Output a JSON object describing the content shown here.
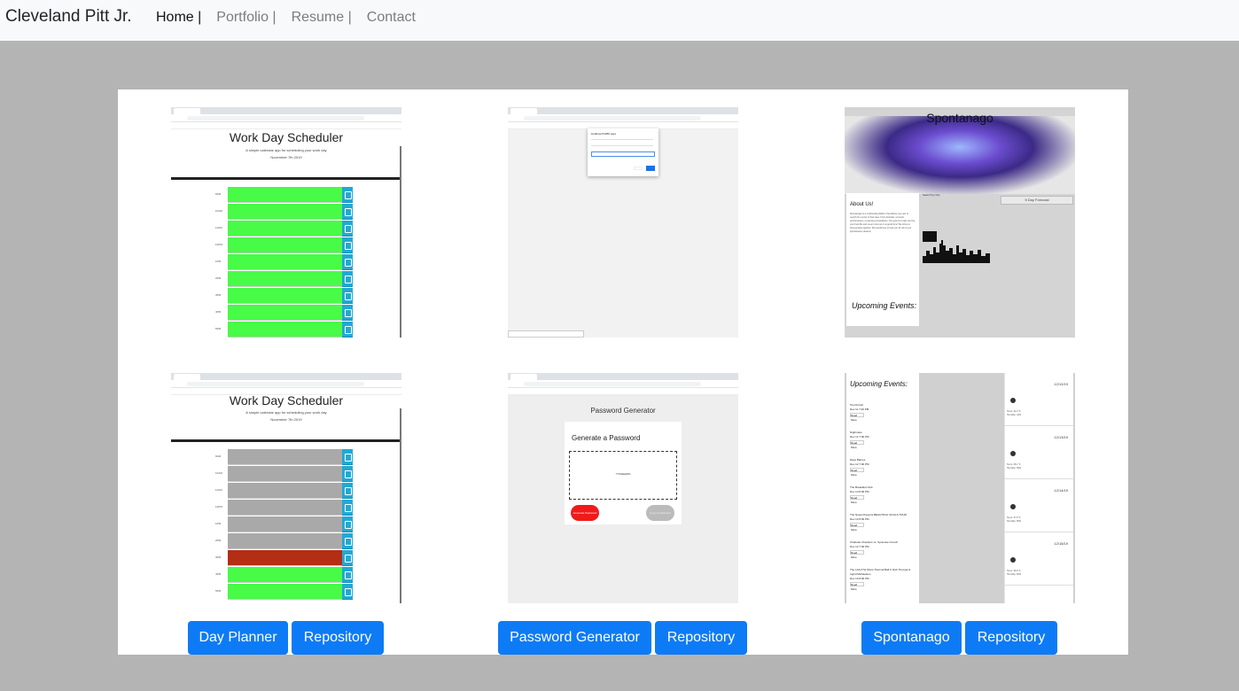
{
  "navbar": {
    "brand": "Cleveland Pitt Jr.",
    "links": [
      {
        "label": "Home |",
        "active": true
      },
      {
        "label": "Portfolio |",
        "active": false
      },
      {
        "label": "Resume |",
        "active": false
      },
      {
        "label": "Contact",
        "active": false
      }
    ]
  },
  "projects": [
    {
      "app_label": "Day Planner",
      "repo_label": "Repository",
      "thumbnail": {
        "title": "Work Day Scheduler",
        "subtitle": "A simple calendar app for scheduling your work day",
        "date": "November 7th 2019"
      }
    },
    {
      "app_label": "Password Generator",
      "repo_label": "Repository",
      "thumbnail": {
        "dialog_title": "localhost:51050 says"
      }
    },
    {
      "app_label": "Spontanago",
      "repo_label": "Repository",
      "thumbnail": {
        "title": "Spontanago",
        "about_title": "About Us!",
        "about_text": "Spontanago is a multimedia platform that allows you user to search for events in their area. From festivals, concerts, performances, to gaming competitions. Our goal is to help you live your best life and never miss out on a good time! We strive to bring people together. We would love to help you for all of your spontaneous desires!",
        "upcoming": "Upcoming Events:",
        "search_label": "Search by City",
        "search_button": "SEARCH",
        "forecast": "5 Day Forecast"
      }
    },
    {
      "app_label": "",
      "repo_label": "",
      "thumbnail": {
        "title": "Work Day Scheduler",
        "subtitle": "A simple calendar app for scheduling your work day",
        "date": "November 7th 2019"
      }
    },
    {
      "app_label": "",
      "repo_label": "",
      "thumbnail": {
        "page_title": "Password Generator",
        "heading": "Generate a Password",
        "password": "YT3d9a&#%",
        "generate": "Generate Password",
        "copy": "Copy to Clipboard"
      }
    },
    {
      "app_label": "",
      "repo_label": "",
      "thumbnail": {
        "title": "Upcoming Events:",
        "events": [
          {
            "name": "Tool Arrival",
            "date": "Dec 11 7:00 PM",
            "btn": "Read More"
          },
          {
            "name": "Nightmare",
            "date": "Dec 12 7:00 PM",
            "btn": "Read More"
          },
          {
            "name": "Dave Barnes",
            "date": "Dec 12 7:00 PM",
            "btn": "Read More"
          },
          {
            "name": "The Breakfast Club",
            "date": "Dec 13 8:00 PM",
            "btn": "Read More"
          },
          {
            "name": "The Noise Presents BEAUTIFUL SOULS TOUR",
            "date": "Dec 13 8:00 PM",
            "btn": "Read More"
          },
          {
            "name": "Charlotte Checkers vs. Syracuse Crunch",
            "date": "Dec 13 7:00 PM",
            "btn": "Read More"
          },
          {
            "name": "The LAA FTH Show Thermal Ball ft. Rob Thomas & Ingrid Michaelson",
            "date": "Dec 13 8:00 PM",
            "btn": "Read More"
          }
        ],
        "forecast": [
          {
            "date": "12/12/19",
            "temp": "Temp: 44.2 °F",
            "humidity": "Humidity: 42%"
          },
          {
            "date": "12/13/19",
            "temp": "Temp: 38.1 °F",
            "humidity": "Humidity: 69%"
          },
          {
            "date": "12/14/19",
            "temp": "Temp: 37.8 °F",
            "humidity": "Humidity: 65%"
          },
          {
            "date": "12/15/19",
            "temp": "Temp: 36.8 °F",
            "humidity": "Humidity: 66%"
          }
        ]
      }
    }
  ],
  "buttons": [
    {
      "label": "Day Planner"
    },
    {
      "label": "Repository"
    },
    {
      "label": "Password Generator"
    },
    {
      "label": "Repository"
    },
    {
      "label": "Spontanago"
    },
    {
      "label": "Repository"
    }
  ],
  "colors": {
    "primary_button": "#0d7bf6",
    "page_background": "#b4b4b4",
    "future_slot": "#47fb47",
    "past_slot": "#a9a9a9",
    "present_slot": "#b42d15"
  }
}
